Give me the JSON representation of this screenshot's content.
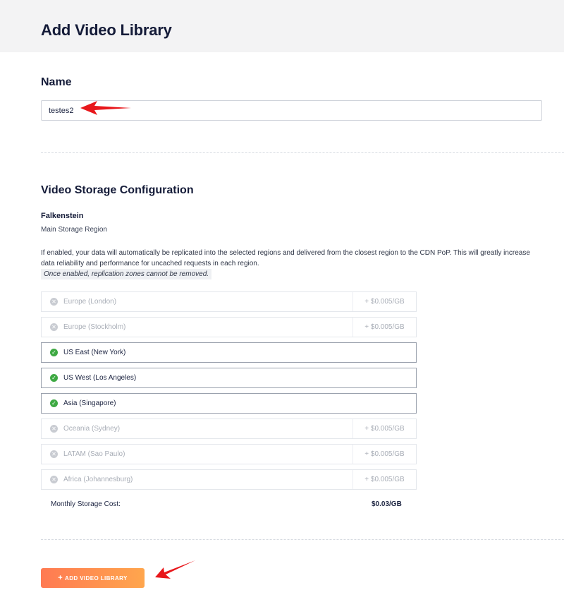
{
  "page": {
    "title": "Add Video Library"
  },
  "name_section": {
    "heading": "Name",
    "value": "testes2"
  },
  "storage": {
    "heading": "Video Storage Configuration",
    "main_region": "Falkenstein",
    "main_region_label": "Main Storage Region",
    "info": "If enabled, your data will automatically be replicated into the selected regions and delivered from the closest region to the CDN PoP. This will greatly increase data reliability and performance for uncached requests in each region.",
    "warning": "Once enabled, replication zones cannot be removed.",
    "regions": [
      {
        "label": "Europe (London)",
        "enabled": false,
        "price": "+ $0.005/GB",
        "icon": "x-circle-icon"
      },
      {
        "label": "Europe (Stockholm)",
        "enabled": false,
        "price": "+ $0.005/GB",
        "icon": "x-circle-icon"
      },
      {
        "label": "US East (New York)",
        "enabled": true,
        "price": "",
        "icon": "check-circle-icon"
      },
      {
        "label": "US West (Los Angeles)",
        "enabled": true,
        "price": "",
        "icon": "check-circle-icon"
      },
      {
        "label": "Asia (Singapore)",
        "enabled": true,
        "price": "",
        "icon": "check-circle-icon"
      },
      {
        "label": "Oceania (Sydney)",
        "enabled": false,
        "price": "+ $0.005/GB",
        "icon": "x-circle-icon"
      },
      {
        "label": "LATAM (Sao Paulo)",
        "enabled": false,
        "price": "+ $0.005/GB",
        "icon": "x-circle-icon"
      },
      {
        "label": "Africa (Johannesburg)",
        "enabled": false,
        "price": "+ $0.005/GB",
        "icon": "x-circle-icon"
      }
    ],
    "cost_label": "Monthly Storage Cost:",
    "cost_value": "$0.03/GB"
  },
  "actions": {
    "add_label": "ADD VIDEO LIBRARY"
  },
  "colors": {
    "accent_start": "#ff7a52",
    "accent_end": "#ffa64d",
    "enabled": "#3ea943",
    "disabled": "#c9ccd2",
    "annotation_arrow": "#e8171b"
  }
}
